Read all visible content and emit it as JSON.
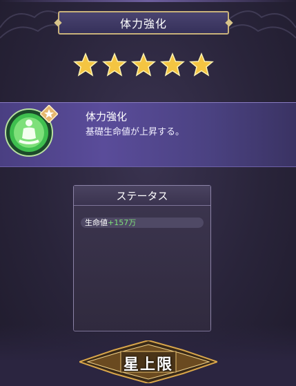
{
  "header": {
    "title": "体力強化"
  },
  "rating": {
    "stars": 5,
    "max_stars": 5
  },
  "skill": {
    "name": "体力強化",
    "description": "基礎生命値が上昇する。",
    "icon": "meditating-figure-icon",
    "badge_icon": "star-badge-icon"
  },
  "status": {
    "title": "ステータス",
    "rows": [
      {
        "label": "生命値",
        "value": "+157万"
      }
    ]
  },
  "footer": {
    "cap_label": "星上限"
  },
  "colors": {
    "accent_gold": "#d8c48a",
    "stat_green": "#7fe27a",
    "band_purple": "#5a4c9a"
  }
}
